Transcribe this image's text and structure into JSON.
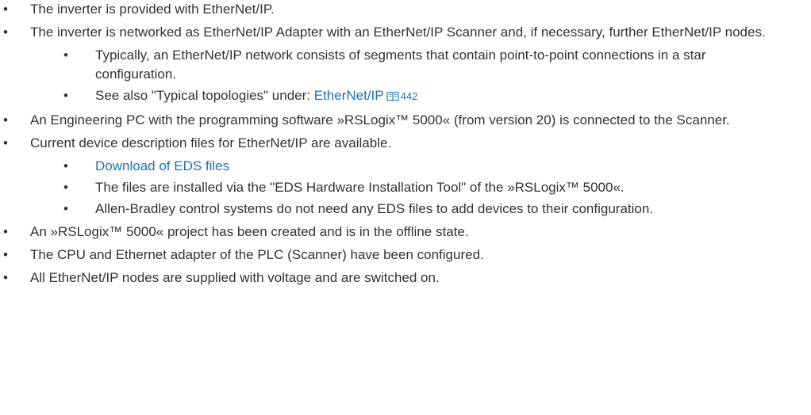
{
  "items": [
    {
      "text": "The inverter is provided with EtherNet/IP."
    },
    {
      "text": "The inverter is networked as EtherNet/IP Adapter with an EtherNet/IP Scanner and, if necessary, further EtherNet/IP nodes.",
      "sub": [
        {
          "text": "Typically, an EtherNet/IP network consists of segments that contain point-to-point connections in a star configuration."
        },
        {
          "prefix": "See also \"Typical topologies\" under: ",
          "link": "EtherNet/IP",
          "page": "442"
        }
      ]
    },
    {
      "text": "An Engineering PC with the programming software »RSLogix™ 5000« (from version 20) is connected to the Scanner."
    },
    {
      "text": "Current device description files for EtherNet/IP are available.",
      "sub": [
        {
          "link": "Download of EDS files"
        },
        {
          "text": "The files are installed via the \"EDS Hardware Installation Tool\" of the »RSLogix™ 5000«."
        },
        {
          "text": "Allen-Bradley control systems do not need any EDS files to add devices to their configuration."
        }
      ]
    },
    {
      "text": "An »RSLogix™ 5000« project has been created and is in the offline state."
    },
    {
      "text": "The CPU and Ethernet adapter of the PLC (Scanner) have been configured."
    },
    {
      "text": "All EtherNet/IP nodes are supplied with voltage and are switched on."
    }
  ],
  "icons": {
    "page_reference": "book-icon"
  },
  "colors": {
    "text": "#333333",
    "link": "#1f70b8"
  }
}
